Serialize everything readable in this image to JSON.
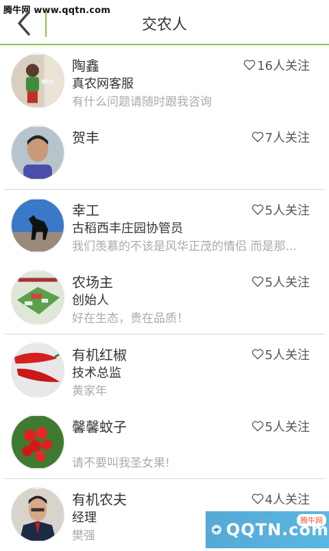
{
  "watermark_top": "腾牛网 www.qqtn.com",
  "header": {
    "title": "交农人"
  },
  "users": [
    {
      "name": "陶鑫",
      "follow": "16人关注",
      "role": "真农网客服",
      "desc": "有什么问题请随时跟我咨询",
      "avatar": "child-photo"
    },
    {
      "name": "贺丰",
      "follow": "7人关注",
      "role": "",
      "desc": "",
      "avatar": "man-photo"
    },
    {
      "name": "幸工",
      "follow": "5人关注",
      "role": "古稻西丰庄园协管员",
      "desc": "我们羡慕的不该是风华正茂的情侣 而是那...",
      "avatar": "horse-photo"
    },
    {
      "name": "农场主",
      "follow": "5人关注",
      "role": "创始人",
      "desc": "好在生态，贵在品质！",
      "avatar": "farm-photo"
    },
    {
      "name": "有机红椒",
      "follow": "5人关注",
      "role": "技术总监",
      "desc": "黄家年",
      "avatar": "red-pepper-photo"
    },
    {
      "name": "馨馨蚊子",
      "follow": "5人关注",
      "role": "",
      "desc": "请不要叫我圣女果!",
      "avatar": "tomato-photo"
    },
    {
      "name": "有机农夫",
      "follow": "4人关注",
      "role": "经理",
      "desc": "樊强",
      "avatar": "man-suit-photo"
    }
  ],
  "watermark_br": {
    "logo": "QQTN.com",
    "badge": "腾牛网"
  },
  "colors": {
    "accent": "#8cc63f"
  }
}
